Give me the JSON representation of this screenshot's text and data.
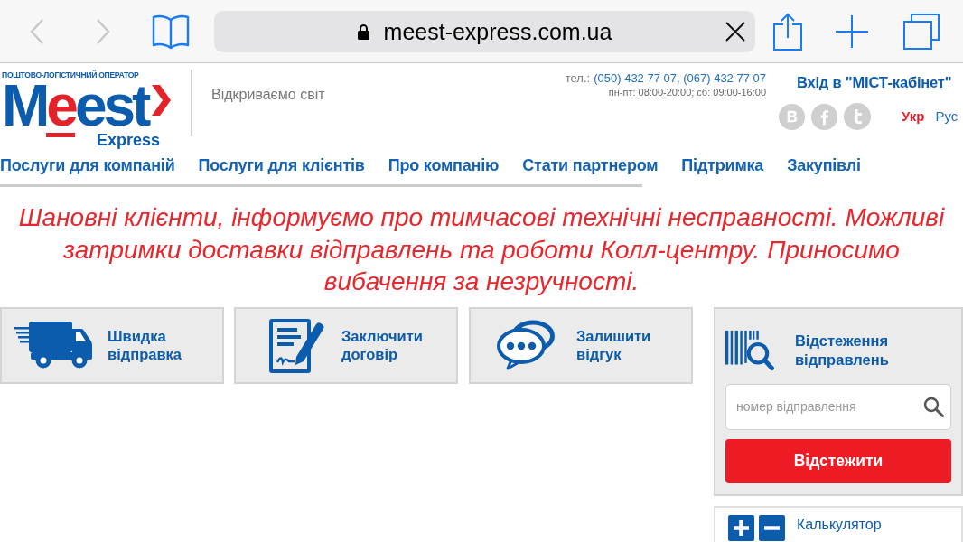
{
  "browser": {
    "url": "meest-express.com.ua"
  },
  "header": {
    "logo": {
      "tagline": "ПОШТОВО-ЛОГІСТИЧНИЙ ОПЕРАТОР",
      "wordmark": "Meest",
      "subtitle": "Express"
    },
    "slogan": "Відкриваємо світ",
    "phone_label": "тел.:",
    "phones": "(050) 432 77 07, (067) 432 77 07",
    "hours": "пн-пт: 08:00-20:00; сб: 09:00-16:00",
    "login_link": "Вхід в \"МІСТ-кабінет\"",
    "languages": [
      {
        "label": "Укр",
        "selected": true
      },
      {
        "label": "Рус",
        "selected": false
      }
    ]
  },
  "nav": [
    {
      "label": "Послуги для компаній"
    },
    {
      "label": "Послуги для клієнтів"
    },
    {
      "label": "Про компанію"
    },
    {
      "label": "Стати партнером"
    },
    {
      "label": "Підтримка"
    },
    {
      "label": "Закупівлі"
    }
  ],
  "notice": "Шановні клієнти, інформуємо про тимчасові технічні несправності. Можливі затримки доставки відправлень та роботи Колл-центру. Приносимо вибачення за незручності.",
  "quick_actions": [
    {
      "label": "Швидка відправка"
    },
    {
      "label": "Заключити договір"
    },
    {
      "label": "Залишити відгук"
    }
  ],
  "tracking": {
    "title": "Відстеження відправлень",
    "placeholder": "номер відправлення",
    "button": "Відстежити"
  },
  "calculator": {
    "title": "Калькулятор"
  }
}
